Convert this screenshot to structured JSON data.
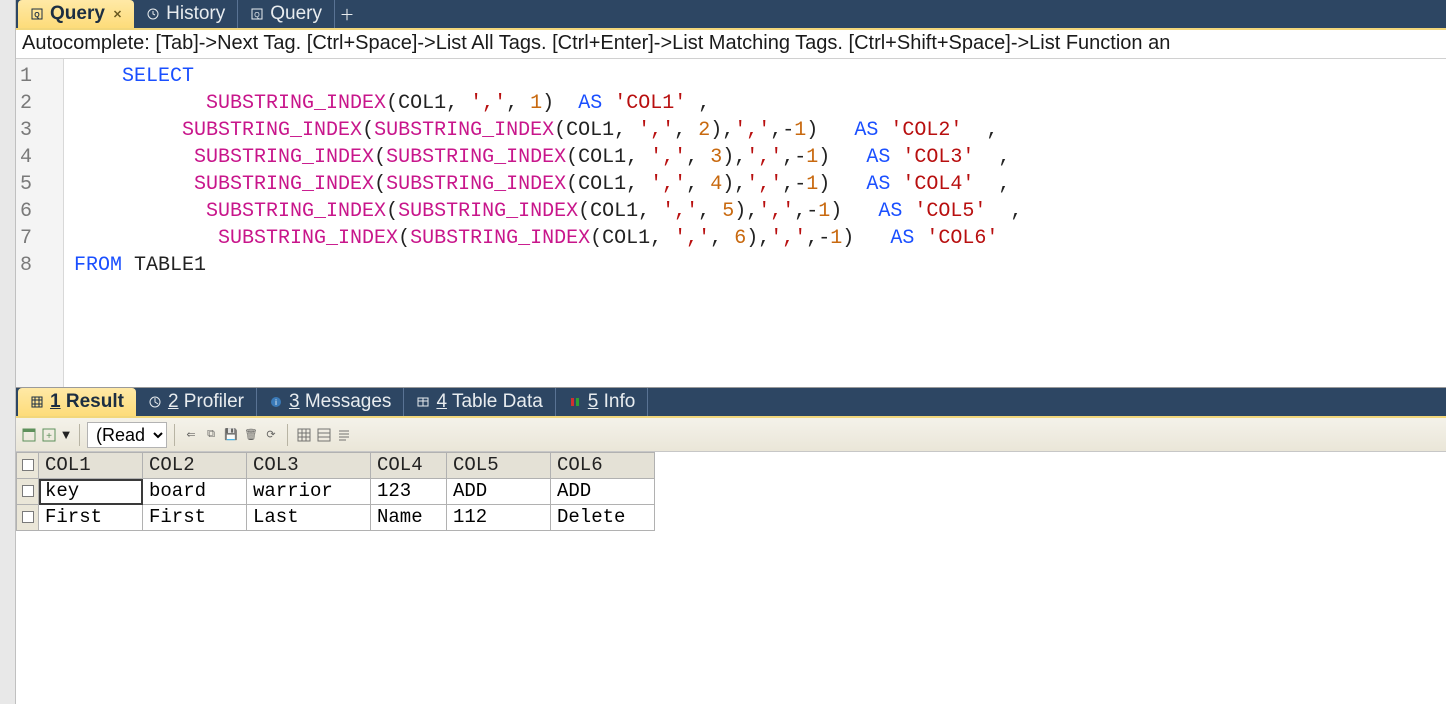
{
  "top_tabs": [
    {
      "label": "Query",
      "active": true,
      "closable": true,
      "icon": "sql-icon",
      "bold": true
    },
    {
      "label": "History",
      "active": false,
      "closable": false,
      "icon": "history-icon",
      "bold": false
    },
    {
      "label": "Query",
      "active": false,
      "closable": false,
      "icon": "sql-icon",
      "bold": false
    }
  ],
  "autocomplete_hint": "Autocomplete: [Tab]->Next Tag. [Ctrl+Space]->List All Tags. [Ctrl+Enter]->List Matching Tags. [Ctrl+Shift+Space]->List Function an",
  "code": {
    "lines": [
      {
        "n": 1,
        "indent": 4,
        "tokens": [
          {
            "cls": "kw",
            "t": "SELECT"
          }
        ]
      },
      {
        "n": 2,
        "indent": 11,
        "tokens": [
          {
            "cls": "fn",
            "t": "SUBSTRING_INDEX"
          },
          {
            "cls": "punct",
            "t": "("
          },
          {
            "cls": "ident",
            "t": "COL1"
          },
          {
            "cls": "punct",
            "t": ", "
          },
          {
            "cls": "str",
            "t": "','"
          },
          {
            "cls": "punct",
            "t": ", "
          },
          {
            "cls": "num",
            "t": "1"
          },
          {
            "cls": "punct",
            "t": ")"
          },
          {
            "cls": "punct",
            "t": "  "
          },
          {
            "cls": "kw",
            "t": "AS"
          },
          {
            "cls": "punct",
            "t": " "
          },
          {
            "cls": "str",
            "t": "'COL1'"
          },
          {
            "cls": "punct",
            "t": " ,"
          }
        ]
      },
      {
        "n": 3,
        "indent": 9,
        "tokens": [
          {
            "cls": "fn",
            "t": "SUBSTRING_INDEX"
          },
          {
            "cls": "punct",
            "t": "("
          },
          {
            "cls": "fn",
            "t": "SUBSTRING_INDEX"
          },
          {
            "cls": "punct",
            "t": "("
          },
          {
            "cls": "ident",
            "t": "COL1"
          },
          {
            "cls": "punct",
            "t": ", "
          },
          {
            "cls": "str",
            "t": "','"
          },
          {
            "cls": "punct",
            "t": ", "
          },
          {
            "cls": "num",
            "t": "2"
          },
          {
            "cls": "punct",
            "t": "),"
          },
          {
            "cls": "str",
            "t": "','"
          },
          {
            "cls": "punct",
            "t": ","
          },
          {
            "cls": "punct",
            "t": "-"
          },
          {
            "cls": "num",
            "t": "1"
          },
          {
            "cls": "punct",
            "t": ")"
          },
          {
            "cls": "punct",
            "t": "   "
          },
          {
            "cls": "kw",
            "t": "AS"
          },
          {
            "cls": "punct",
            "t": " "
          },
          {
            "cls": "str",
            "t": "'COL2'"
          },
          {
            "cls": "punct",
            "t": "  ,"
          }
        ]
      },
      {
        "n": 4,
        "indent": 10,
        "tokens": [
          {
            "cls": "fn",
            "t": "SUBSTRING_INDEX"
          },
          {
            "cls": "punct",
            "t": "("
          },
          {
            "cls": "fn",
            "t": "SUBSTRING_INDEX"
          },
          {
            "cls": "punct",
            "t": "("
          },
          {
            "cls": "ident",
            "t": "COL1"
          },
          {
            "cls": "punct",
            "t": ", "
          },
          {
            "cls": "str",
            "t": "','"
          },
          {
            "cls": "punct",
            "t": ", "
          },
          {
            "cls": "num",
            "t": "3"
          },
          {
            "cls": "punct",
            "t": "),"
          },
          {
            "cls": "str",
            "t": "','"
          },
          {
            "cls": "punct",
            "t": ","
          },
          {
            "cls": "punct",
            "t": "-"
          },
          {
            "cls": "num",
            "t": "1"
          },
          {
            "cls": "punct",
            "t": ")"
          },
          {
            "cls": "punct",
            "t": "   "
          },
          {
            "cls": "kw",
            "t": "AS"
          },
          {
            "cls": "punct",
            "t": " "
          },
          {
            "cls": "str",
            "t": "'COL3'"
          },
          {
            "cls": "punct",
            "t": "  ,"
          }
        ]
      },
      {
        "n": 5,
        "indent": 10,
        "tokens": [
          {
            "cls": "fn",
            "t": "SUBSTRING_INDEX"
          },
          {
            "cls": "punct",
            "t": "("
          },
          {
            "cls": "fn",
            "t": "SUBSTRING_INDEX"
          },
          {
            "cls": "punct",
            "t": "("
          },
          {
            "cls": "ident",
            "t": "COL1"
          },
          {
            "cls": "punct",
            "t": ", "
          },
          {
            "cls": "str",
            "t": "','"
          },
          {
            "cls": "punct",
            "t": ", "
          },
          {
            "cls": "num",
            "t": "4"
          },
          {
            "cls": "punct",
            "t": "),"
          },
          {
            "cls": "str",
            "t": "','"
          },
          {
            "cls": "punct",
            "t": ","
          },
          {
            "cls": "punct",
            "t": "-"
          },
          {
            "cls": "num",
            "t": "1"
          },
          {
            "cls": "punct",
            "t": ")"
          },
          {
            "cls": "punct",
            "t": "   "
          },
          {
            "cls": "kw",
            "t": "AS"
          },
          {
            "cls": "punct",
            "t": " "
          },
          {
            "cls": "str",
            "t": "'COL4'"
          },
          {
            "cls": "punct",
            "t": "  ,"
          }
        ]
      },
      {
        "n": 6,
        "indent": 11,
        "tokens": [
          {
            "cls": "fn",
            "t": "SUBSTRING_INDEX"
          },
          {
            "cls": "punct",
            "t": "("
          },
          {
            "cls": "fn",
            "t": "SUBSTRING_INDEX"
          },
          {
            "cls": "punct",
            "t": "("
          },
          {
            "cls": "ident",
            "t": "COL1"
          },
          {
            "cls": "punct",
            "t": ", "
          },
          {
            "cls": "str",
            "t": "','"
          },
          {
            "cls": "punct",
            "t": ", "
          },
          {
            "cls": "num",
            "t": "5"
          },
          {
            "cls": "punct",
            "t": "),"
          },
          {
            "cls": "str",
            "t": "','"
          },
          {
            "cls": "punct",
            "t": ","
          },
          {
            "cls": "punct",
            "t": "-"
          },
          {
            "cls": "num",
            "t": "1"
          },
          {
            "cls": "punct",
            "t": ")"
          },
          {
            "cls": "punct",
            "t": "   "
          },
          {
            "cls": "kw",
            "t": "AS"
          },
          {
            "cls": "punct",
            "t": " "
          },
          {
            "cls": "str",
            "t": "'COL5'"
          },
          {
            "cls": "punct",
            "t": "  ,"
          }
        ]
      },
      {
        "n": 7,
        "indent": 12,
        "tokens": [
          {
            "cls": "fn",
            "t": "SUBSTRING_INDEX"
          },
          {
            "cls": "punct",
            "t": "("
          },
          {
            "cls": "fn",
            "t": "SUBSTRING_INDEX"
          },
          {
            "cls": "punct",
            "t": "("
          },
          {
            "cls": "ident",
            "t": "COL1"
          },
          {
            "cls": "punct",
            "t": ", "
          },
          {
            "cls": "str",
            "t": "','"
          },
          {
            "cls": "punct",
            "t": ", "
          },
          {
            "cls": "num",
            "t": "6"
          },
          {
            "cls": "punct",
            "t": "),"
          },
          {
            "cls": "str",
            "t": "','"
          },
          {
            "cls": "punct",
            "t": ","
          },
          {
            "cls": "punct",
            "t": "-"
          },
          {
            "cls": "num",
            "t": "1"
          },
          {
            "cls": "punct",
            "t": ")"
          },
          {
            "cls": "punct",
            "t": "   "
          },
          {
            "cls": "kw",
            "t": "AS"
          },
          {
            "cls": "punct",
            "t": " "
          },
          {
            "cls": "str",
            "t": "'COL6'"
          }
        ]
      },
      {
        "n": 8,
        "indent": 0,
        "tokens": [
          {
            "cls": "kw",
            "t": "FROM"
          },
          {
            "cls": "punct",
            "t": " "
          },
          {
            "cls": "ident",
            "t": "TABLE1"
          }
        ]
      }
    ]
  },
  "result_tabs": [
    {
      "mnemonic": "1",
      "label": "Result",
      "active": true,
      "icon": "grid-icon"
    },
    {
      "mnemonic": "2",
      "label": "Profiler",
      "active": false,
      "icon": "profiler-icon"
    },
    {
      "mnemonic": "3",
      "label": "Messages",
      "active": false,
      "icon": "messages-icon"
    },
    {
      "mnemonic": "4",
      "label": "Table Data",
      "active": false,
      "icon": "table-icon"
    },
    {
      "mnemonic": "5",
      "label": "Info",
      "active": false,
      "icon": "info-icon"
    }
  ],
  "grid": {
    "mode_options": [
      "(Read"
    ],
    "mode_selected": "(Read",
    "columns": [
      "COL1",
      "COL2",
      "COL3",
      "COL4",
      "COL5",
      "COL6"
    ],
    "rows": [
      [
        "key",
        "board",
        " warrior",
        "123",
        "ADD",
        "ADD"
      ],
      [
        "First",
        "First",
        " Last",
        " Name",
        "112",
        "Delete"
      ]
    ],
    "active_cell": {
      "row": 0,
      "col": 0
    }
  }
}
